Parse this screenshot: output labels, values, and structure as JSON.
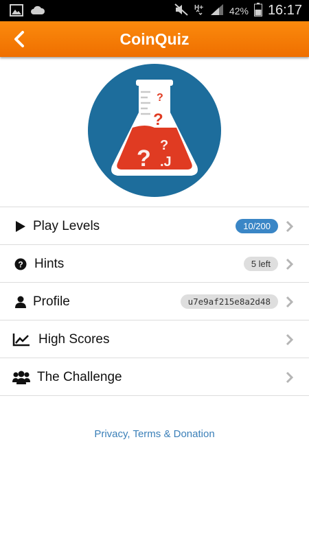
{
  "status_bar": {
    "battery": "42%",
    "time": "16:17",
    "icons": [
      "image-icon",
      "cloud-icon",
      "mute-icon",
      "hplus-icon",
      "signal-icon",
      "battery-icon"
    ]
  },
  "app_bar": {
    "title": "CoinQuiz",
    "back_icon": "chevron-left-icon"
  },
  "hero": {
    "icon": "flask-icon",
    "colors": {
      "circle": "#1d6d9c",
      "liquid": "#e03b22",
      "glass": "#ffffff"
    }
  },
  "menu": {
    "items": [
      {
        "label": "Play Levels",
        "icon": "play-icon",
        "badge": "10/200",
        "badge_style": "blue"
      },
      {
        "label": "Hints",
        "icon": "question-circle-icon",
        "badge": "5 left",
        "badge_style": "grey"
      },
      {
        "label": "Profile",
        "icon": "user-icon",
        "badge": "u7e9af215e8a2d48",
        "badge_style": "grey-mono"
      },
      {
        "label": "High Scores",
        "icon": "line-chart-icon",
        "badge": "",
        "badge_style": ""
      },
      {
        "label": "The Challenge",
        "icon": "users-icon",
        "badge": "",
        "badge_style": ""
      }
    ]
  },
  "footer": {
    "link": "Privacy, Terms & Donation"
  },
  "colors": {
    "accent": "#f57c00",
    "link": "#3a7fb8",
    "badge_blue": "#3a86c6"
  }
}
